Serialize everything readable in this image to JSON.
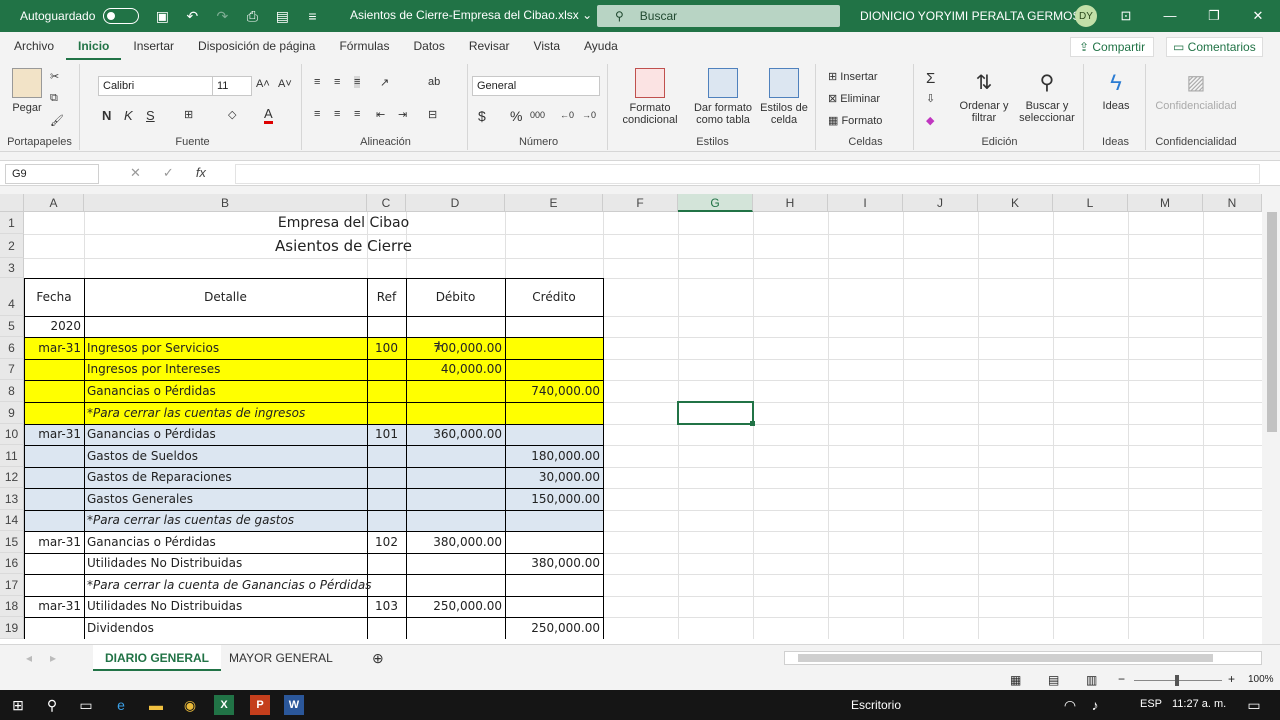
{
  "titlebar": {
    "autosave_label": "Autoguardado",
    "doc_title": "Asientos de Cierre-Empresa del Cibao.xlsx",
    "doc_title_caret": "⌄",
    "search_placeholder": "Buscar",
    "user_name": "DIONICIO YORYIMI PERALTA GERMOSEN",
    "user_initials": "DY"
  },
  "menu": {
    "items": [
      "Archivo",
      "Inicio",
      "Insertar",
      "Disposición de página",
      "Fórmulas",
      "Datos",
      "Revisar",
      "Vista",
      "Ayuda"
    ],
    "share": "Compartir",
    "comments": "Comentarios"
  },
  "ribbon": {
    "portapapeles": {
      "label": "Portapapeles",
      "paste": "Pegar"
    },
    "fuente": {
      "label": "Fuente",
      "font_name": "Calibri",
      "font_size": "11",
      "bold": "N",
      "italic": "K",
      "underline": "S"
    },
    "alineacion": {
      "label": "Alineación"
    },
    "numero": {
      "label": "Número",
      "format": "General"
    },
    "estilos": {
      "label": "Estilos",
      "b1a": "Formato",
      "b1b": "condicional",
      "b2a": "Dar formato",
      "b2b": "como tabla",
      "b3a": "Estilos de",
      "b3b": "celda"
    },
    "celdas": {
      "label": "Celdas",
      "insertar": "Insertar",
      "eliminar": "Eliminar",
      "formato": "Formato"
    },
    "edicion": {
      "label": "Edición",
      "b1a": "Ordenar y",
      "b1b": "filtrar",
      "b2a": "Buscar y",
      "b2b": "seleccionar"
    },
    "ideas": {
      "label": "Ideas",
      "btn": "Ideas"
    },
    "confidencialidad": {
      "label": "Confidencialidad",
      "btn": "Confidencialidad"
    }
  },
  "formula_bar": {
    "name_box": "G9",
    "formula": ""
  },
  "columns": [
    "A",
    "B",
    "C",
    "D",
    "E",
    "F",
    "G",
    "H",
    "I",
    "J",
    "K",
    "L",
    "M",
    "N"
  ],
  "rows": [
    "1",
    "2",
    "3",
    "4",
    "5",
    "6",
    "7",
    "8",
    "9",
    "10",
    "11",
    "12",
    "13",
    "14",
    "15",
    "16",
    "17",
    "18",
    "19"
  ],
  "sheet": {
    "title1": "Empresa del Cibao",
    "title2": "Asientos de Cierre",
    "headers": {
      "fecha": "Fecha",
      "detalle": "Detalle",
      "ref": "Ref",
      "debito": "Débito",
      "credito": "Crédito"
    },
    "year": "2020",
    "entries": [
      {
        "row": 6,
        "fecha": "mar-31",
        "detalle": "Ingresos por Servicios",
        "ref": "100",
        "debito": "700,000.00",
        "credito": ""
      },
      {
        "row": 7,
        "fecha": "",
        "detalle": "Ingresos por Intereses",
        "ref": "",
        "debito": "40,000.00",
        "credito": ""
      },
      {
        "row": 8,
        "fecha": "",
        "detalle": "Ganancias o Pérdidas",
        "ref": "",
        "debito": "",
        "credito": "740,000.00"
      },
      {
        "row": 9,
        "fecha": "",
        "detalle": "*Para cerrar las cuentas de ingresos",
        "ref": "",
        "debito": "",
        "credito": "",
        "italic": true
      },
      {
        "row": 10,
        "fecha": "mar-31",
        "detalle": "Ganancias o Pérdidas",
        "ref": "101",
        "debito": "360,000.00",
        "credito": ""
      },
      {
        "row": 11,
        "fecha": "",
        "detalle": "Gastos de Sueldos",
        "ref": "",
        "debito": "",
        "credito": "180,000.00"
      },
      {
        "row": 12,
        "fecha": "",
        "detalle": "Gastos de Reparaciones",
        "ref": "",
        "debito": "",
        "credito": "30,000.00"
      },
      {
        "row": 13,
        "fecha": "",
        "detalle": "Gastos Generales",
        "ref": "",
        "debito": "",
        "credito": "150,000.00"
      },
      {
        "row": 14,
        "fecha": "",
        "detalle": "*Para cerrar las cuentas de gastos",
        "ref": "",
        "debito": "",
        "credito": "",
        "italic": true
      },
      {
        "row": 15,
        "fecha": "mar-31",
        "detalle": "Ganancias o Pérdidas",
        "ref": "102",
        "debito": "380,000.00",
        "credito": ""
      },
      {
        "row": 16,
        "fecha": "",
        "detalle": "Utilidades No Distribuidas",
        "ref": "",
        "debito": "",
        "credito": "380,000.00"
      },
      {
        "row": 17,
        "fecha": "",
        "detalle": "*Para cerrar la cuenta de Ganancias o Pérdidas",
        "ref": "",
        "debito": "",
        "credito": "",
        "italic": true
      },
      {
        "row": 18,
        "fecha": "mar-31",
        "detalle": "Utilidades No Distribuidas",
        "ref": "103",
        "debito": "250,000.00",
        "credito": ""
      },
      {
        "row": 19,
        "fecha": "",
        "detalle": "Dividendos",
        "ref": "",
        "debito": "",
        "credito": "250,000.00"
      }
    ]
  },
  "sheet_tabs": [
    "DIARIO GENERAL",
    "MAYOR GENERAL"
  ],
  "status": {
    "zoom": "100%"
  },
  "taskbar": {
    "desktop": "Escritorio",
    "lang": "ESP",
    "time": "11:27 a. m."
  },
  "colors": {
    "excel_green": "#217346",
    "yellow_fill": "#ffff00",
    "blue_fill": "#dce6f1"
  }
}
